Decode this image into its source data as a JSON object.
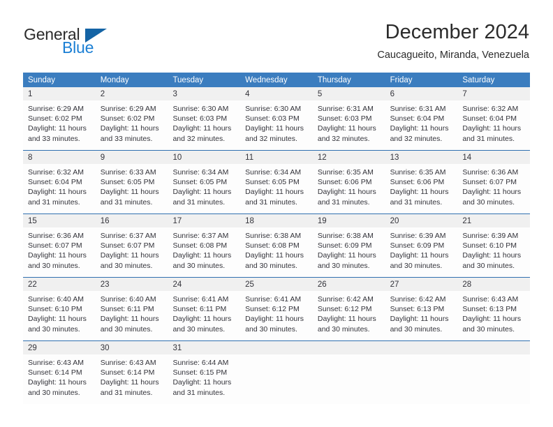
{
  "brand": {
    "name_part1": "General",
    "name_part2": "Blue",
    "icon": "triangle-icon"
  },
  "header": {
    "title": "December 2024",
    "subtitle": "Caucagueito, Miranda, Venezuela"
  },
  "colors": {
    "header_blue": "#3b7dbf",
    "week_divider": "#2f6fb0",
    "daynum_band": "#f0f0f0",
    "brand_blue": "#1b7fd4",
    "brand_triangle": "#1464a5",
    "text": "#33333a"
  },
  "calendar": {
    "weekday_headers": [
      "Sunday",
      "Monday",
      "Tuesday",
      "Wednesday",
      "Thursday",
      "Friday",
      "Saturday"
    ],
    "weeks": [
      [
        {
          "day": "1",
          "sunrise": "Sunrise: 6:29 AM",
          "sunset": "Sunset: 6:02 PM",
          "daylight1": "Daylight: 11 hours",
          "daylight2": "and 33 minutes."
        },
        {
          "day": "2",
          "sunrise": "Sunrise: 6:29 AM",
          "sunset": "Sunset: 6:02 PM",
          "daylight1": "Daylight: 11 hours",
          "daylight2": "and 33 minutes."
        },
        {
          "day": "3",
          "sunrise": "Sunrise: 6:30 AM",
          "sunset": "Sunset: 6:03 PM",
          "daylight1": "Daylight: 11 hours",
          "daylight2": "and 32 minutes."
        },
        {
          "day": "4",
          "sunrise": "Sunrise: 6:30 AM",
          "sunset": "Sunset: 6:03 PM",
          "daylight1": "Daylight: 11 hours",
          "daylight2": "and 32 minutes."
        },
        {
          "day": "5",
          "sunrise": "Sunrise: 6:31 AM",
          "sunset": "Sunset: 6:03 PM",
          "daylight1": "Daylight: 11 hours",
          "daylight2": "and 32 minutes."
        },
        {
          "day": "6",
          "sunrise": "Sunrise: 6:31 AM",
          "sunset": "Sunset: 6:04 PM",
          "daylight1": "Daylight: 11 hours",
          "daylight2": "and 32 minutes."
        },
        {
          "day": "7",
          "sunrise": "Sunrise: 6:32 AM",
          "sunset": "Sunset: 6:04 PM",
          "daylight1": "Daylight: 11 hours",
          "daylight2": "and 31 minutes."
        }
      ],
      [
        {
          "day": "8",
          "sunrise": "Sunrise: 6:32 AM",
          "sunset": "Sunset: 6:04 PM",
          "daylight1": "Daylight: 11 hours",
          "daylight2": "and 31 minutes."
        },
        {
          "day": "9",
          "sunrise": "Sunrise: 6:33 AM",
          "sunset": "Sunset: 6:05 PM",
          "daylight1": "Daylight: 11 hours",
          "daylight2": "and 31 minutes."
        },
        {
          "day": "10",
          "sunrise": "Sunrise: 6:34 AM",
          "sunset": "Sunset: 6:05 PM",
          "daylight1": "Daylight: 11 hours",
          "daylight2": "and 31 minutes."
        },
        {
          "day": "11",
          "sunrise": "Sunrise: 6:34 AM",
          "sunset": "Sunset: 6:05 PM",
          "daylight1": "Daylight: 11 hours",
          "daylight2": "and 31 minutes."
        },
        {
          "day": "12",
          "sunrise": "Sunrise: 6:35 AM",
          "sunset": "Sunset: 6:06 PM",
          "daylight1": "Daylight: 11 hours",
          "daylight2": "and 31 minutes."
        },
        {
          "day": "13",
          "sunrise": "Sunrise: 6:35 AM",
          "sunset": "Sunset: 6:06 PM",
          "daylight1": "Daylight: 11 hours",
          "daylight2": "and 31 minutes."
        },
        {
          "day": "14",
          "sunrise": "Sunrise: 6:36 AM",
          "sunset": "Sunset: 6:07 PM",
          "daylight1": "Daylight: 11 hours",
          "daylight2": "and 30 minutes."
        }
      ],
      [
        {
          "day": "15",
          "sunrise": "Sunrise: 6:36 AM",
          "sunset": "Sunset: 6:07 PM",
          "daylight1": "Daylight: 11 hours",
          "daylight2": "and 30 minutes."
        },
        {
          "day": "16",
          "sunrise": "Sunrise: 6:37 AM",
          "sunset": "Sunset: 6:07 PM",
          "daylight1": "Daylight: 11 hours",
          "daylight2": "and 30 minutes."
        },
        {
          "day": "17",
          "sunrise": "Sunrise: 6:37 AM",
          "sunset": "Sunset: 6:08 PM",
          "daylight1": "Daylight: 11 hours",
          "daylight2": "and 30 minutes."
        },
        {
          "day": "18",
          "sunrise": "Sunrise: 6:38 AM",
          "sunset": "Sunset: 6:08 PM",
          "daylight1": "Daylight: 11 hours",
          "daylight2": "and 30 minutes."
        },
        {
          "day": "19",
          "sunrise": "Sunrise: 6:38 AM",
          "sunset": "Sunset: 6:09 PM",
          "daylight1": "Daylight: 11 hours",
          "daylight2": "and 30 minutes."
        },
        {
          "day": "20",
          "sunrise": "Sunrise: 6:39 AM",
          "sunset": "Sunset: 6:09 PM",
          "daylight1": "Daylight: 11 hours",
          "daylight2": "and 30 minutes."
        },
        {
          "day": "21",
          "sunrise": "Sunrise: 6:39 AM",
          "sunset": "Sunset: 6:10 PM",
          "daylight1": "Daylight: 11 hours",
          "daylight2": "and 30 minutes."
        }
      ],
      [
        {
          "day": "22",
          "sunrise": "Sunrise: 6:40 AM",
          "sunset": "Sunset: 6:10 PM",
          "daylight1": "Daylight: 11 hours",
          "daylight2": "and 30 minutes."
        },
        {
          "day": "23",
          "sunrise": "Sunrise: 6:40 AM",
          "sunset": "Sunset: 6:11 PM",
          "daylight1": "Daylight: 11 hours",
          "daylight2": "and 30 minutes."
        },
        {
          "day": "24",
          "sunrise": "Sunrise: 6:41 AM",
          "sunset": "Sunset: 6:11 PM",
          "daylight1": "Daylight: 11 hours",
          "daylight2": "and 30 minutes."
        },
        {
          "day": "25",
          "sunrise": "Sunrise: 6:41 AM",
          "sunset": "Sunset: 6:12 PM",
          "daylight1": "Daylight: 11 hours",
          "daylight2": "and 30 minutes."
        },
        {
          "day": "26",
          "sunrise": "Sunrise: 6:42 AM",
          "sunset": "Sunset: 6:12 PM",
          "daylight1": "Daylight: 11 hours",
          "daylight2": "and 30 minutes."
        },
        {
          "day": "27",
          "sunrise": "Sunrise: 6:42 AM",
          "sunset": "Sunset: 6:13 PM",
          "daylight1": "Daylight: 11 hours",
          "daylight2": "and 30 minutes."
        },
        {
          "day": "28",
          "sunrise": "Sunrise: 6:43 AM",
          "sunset": "Sunset: 6:13 PM",
          "daylight1": "Daylight: 11 hours",
          "daylight2": "and 30 minutes."
        }
      ],
      [
        {
          "day": "29",
          "sunrise": "Sunrise: 6:43 AM",
          "sunset": "Sunset: 6:14 PM",
          "daylight1": "Daylight: 11 hours",
          "daylight2": "and 30 minutes."
        },
        {
          "day": "30",
          "sunrise": "Sunrise: 6:43 AM",
          "sunset": "Sunset: 6:14 PM",
          "daylight1": "Daylight: 11 hours",
          "daylight2": "and 31 minutes."
        },
        {
          "day": "31",
          "sunrise": "Sunrise: 6:44 AM",
          "sunset": "Sunset: 6:15 PM",
          "daylight1": "Daylight: 11 hours",
          "daylight2": "and 31 minutes."
        },
        {
          "day": "",
          "sunrise": "",
          "sunset": "",
          "daylight1": "",
          "daylight2": ""
        },
        {
          "day": "",
          "sunrise": "",
          "sunset": "",
          "daylight1": "",
          "daylight2": ""
        },
        {
          "day": "",
          "sunrise": "",
          "sunset": "",
          "daylight1": "",
          "daylight2": ""
        },
        {
          "day": "",
          "sunrise": "",
          "sunset": "",
          "daylight1": "",
          "daylight2": ""
        }
      ]
    ]
  }
}
